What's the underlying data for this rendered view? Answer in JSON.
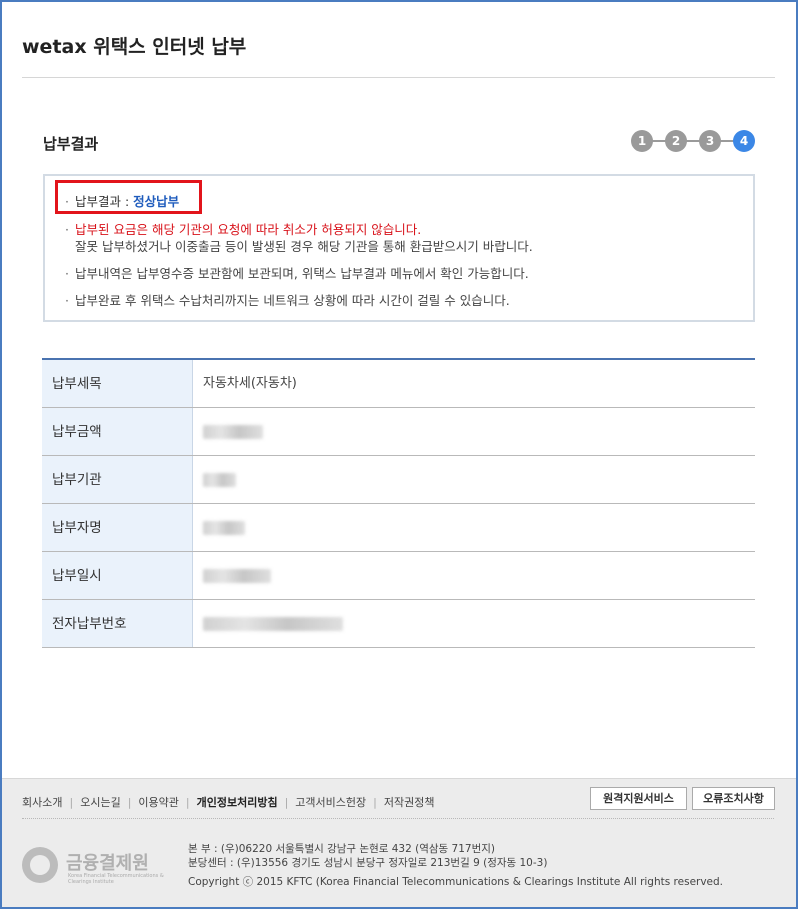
{
  "header": {
    "title": "wetax 위택스 인터넷 납부"
  },
  "section": {
    "title": "납부결과"
  },
  "steps": [
    "1",
    "2",
    "3",
    "4"
  ],
  "active_step": 4,
  "notice": {
    "result_label": "납부결과 : ",
    "result_value": "정상납부",
    "bullet": "·",
    "line2_red": "납부된 요금은 해당 기관의 요청에 따라 취소가 허용되지 않습니다.",
    "line2_cont": "잘못 납부하셨거나 이중출금 등이 발생된 경우 해당 기관을 통해 환급받으시기 바랍니다.",
    "line3": "납부내역은 납부영수증 보관함에 보관되며, 위택스 납부결과 메뉴에서 확인 가능합니다.",
    "line4": "납부완료 후 위택스 수납처리까지는 네트워크 상황에 따라 시간이 걸릴 수 있습니다."
  },
  "table": {
    "rows": [
      {
        "label": "납부세목",
        "value": "자동차세(자동차)"
      },
      {
        "label": "납부금액",
        "value": ""
      },
      {
        "label": "납부기관",
        "value": ""
      },
      {
        "label": "납부자명",
        "value": ""
      },
      {
        "label": "납부일시",
        "value": ""
      },
      {
        "label": "전자납부번호",
        "value": ""
      }
    ]
  },
  "footer": {
    "links": [
      "회사소개",
      "오시는길",
      "이용약관",
      "개인정보처리방침",
      "고객서비스헌장",
      "저작권정책"
    ],
    "remote_button": "원격지원서비스",
    "error_button": "오류조치사항",
    "logo_name": "금융결제원",
    "logo_sub": "Korea Financial Telecommunications & Clearings Institute",
    "address1": "본  부 : (우)06220 서울특별시 강남구 논현로 432 (역삼동 717번지)",
    "address2": "분당센터 : (우)13556 경기도 성남시 분당구 정자일로 213번길 9 (정자동 10-3)",
    "copyright": "Copyright ⓒ 2015 KFTC (Korea Financial Telecommunications & Clearings Institute All rights reserved."
  },
  "colors": {
    "accent_blue": "#3b87e6",
    "highlight_red": "#e2141b",
    "table_header_bg": "#eaf2fb"
  }
}
